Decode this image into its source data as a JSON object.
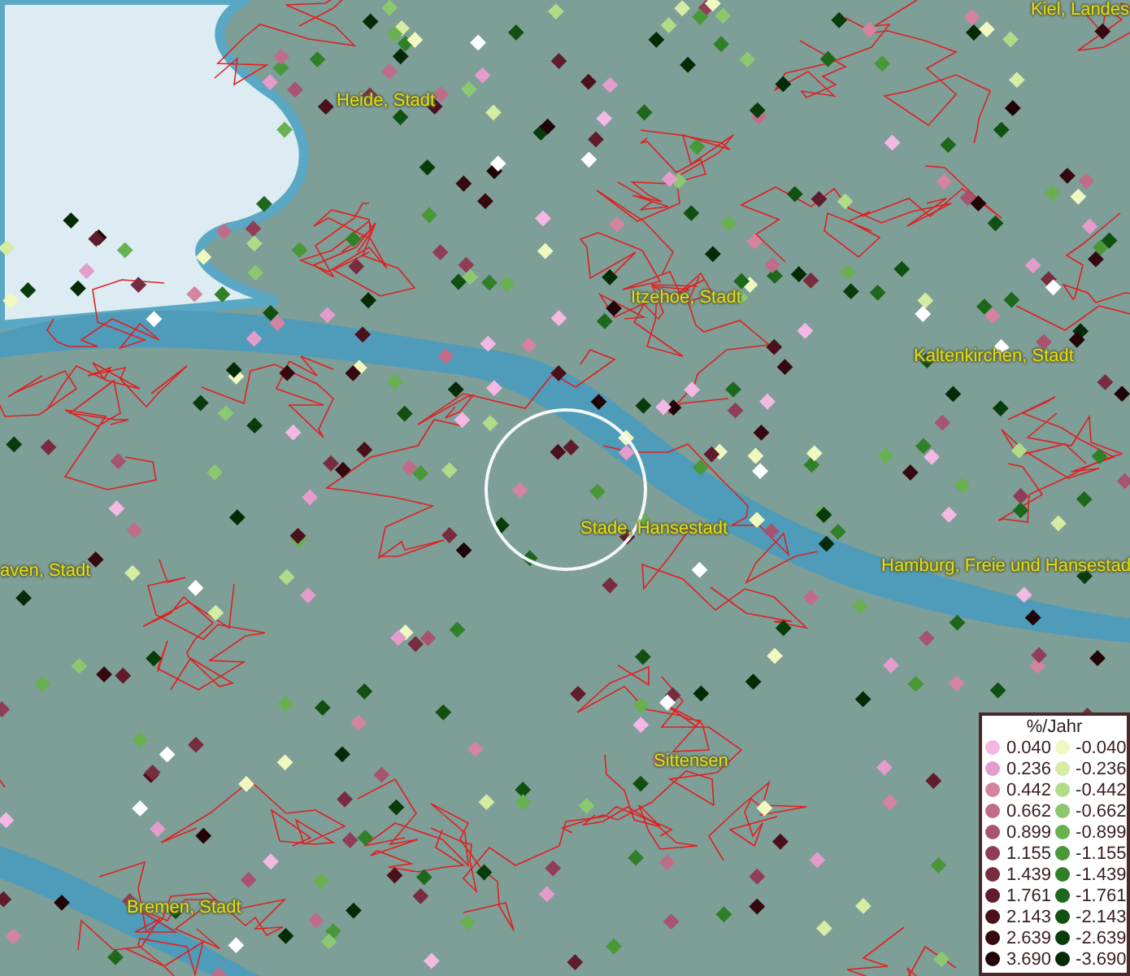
{
  "map": {
    "place_labels": [
      {
        "text": "Kiel, Landes"
      },
      {
        "text": "Heide, Stadt"
      },
      {
        "text": "Itzehoe, Stadt"
      },
      {
        "text": "Kaltenkirchen, Stadt"
      },
      {
        "text": "Stade, Hansestadt"
      },
      {
        "text": "aven, Stadt"
      },
      {
        "text": "Hamburg, Freie und Hansestad"
      },
      {
        "text": "Sittensen"
      },
      {
        "text": "Bremen, Stadt"
      }
    ]
  },
  "legend": {
    "title": "%/Jahr",
    "positive": [
      {
        "label": "0.040",
        "color": "#f4b8e4"
      },
      {
        "label": "0.236",
        "color": "#e49ccc"
      },
      {
        "label": "0.442",
        "color": "#d4849f"
      },
      {
        "label": "0.662",
        "color": "#c06c88"
      },
      {
        "label": "0.899",
        "color": "#a85470"
      },
      {
        "label": "1.155",
        "color": "#903e58"
      },
      {
        "label": "1.439",
        "color": "#782c40"
      },
      {
        "label": "1.761",
        "color": "#601c2c"
      },
      {
        "label": "2.143",
        "color": "#4a101c"
      },
      {
        "label": "2.639",
        "color": "#360810"
      },
      {
        "label": "3.690",
        "color": "#200408"
      }
    ],
    "negative": [
      {
        "label": "-0.040",
        "color": "#f0f8c0"
      },
      {
        "label": "-0.236",
        "color": "#d4eca4"
      },
      {
        "label": "-0.442",
        "color": "#b0dc88"
      },
      {
        "label": "-0.662",
        "color": "#8cc870"
      },
      {
        "label": "-0.899",
        "color": "#68b050"
      },
      {
        "label": "-1.155",
        "color": "#489838"
      },
      {
        "label": "-1.439",
        "color": "#308028"
      },
      {
        "label": "-1.761",
        "color": "#1e681c"
      },
      {
        "label": "-2.143",
        "color": "#105010"
      },
      {
        "label": "-2.639",
        "color": "#083c0a"
      },
      {
        "label": "-3.690",
        "color": "#042a06"
      }
    ]
  }
}
